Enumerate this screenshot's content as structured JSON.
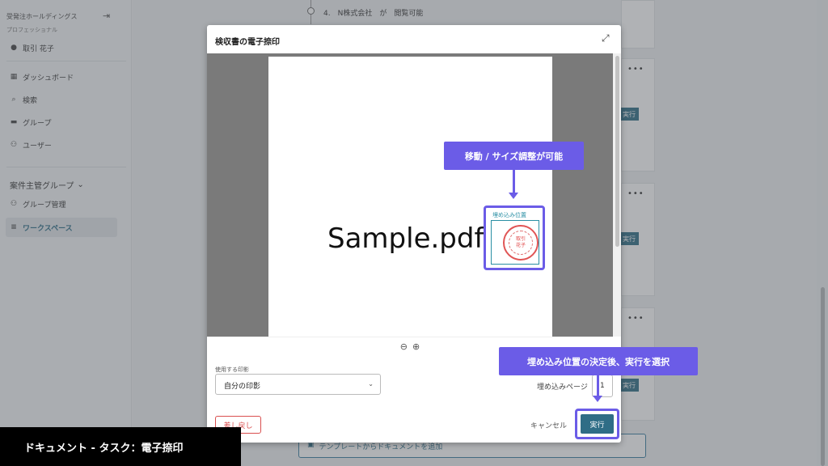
{
  "sidebar": {
    "company": "受発注ホールディングス",
    "plan": "プロフェッショナル",
    "user": "取引 花子",
    "nav": [
      "ダッシュボード",
      "検索",
      "グループ",
      "ユーザー"
    ],
    "group_header": "案件主管グループ",
    "group_items": [
      "グループ管理",
      "ワークスペース"
    ]
  },
  "background": {
    "timeline_item": "4.　N株式会社　が　閲覧可能",
    "run_short": "実行",
    "template_button": "テンプレートからドキュメントを追加"
  },
  "modal": {
    "title": "検収書の電子捺印",
    "document_text": "Sample.pdf",
    "stamp_label": "埋め込み位置",
    "seal_name_top": "取引",
    "seal_name_bottom": "花子",
    "seal_label": "使用する印影",
    "seal_value": "自分の印影",
    "embed_page_label": "埋め込みページ",
    "embed_page_value": "1",
    "back_button": "差し戻し",
    "cancel_button": "キャンセル",
    "run_button": "実行"
  },
  "callouts": {
    "move": "移動 / サイズ調整が可能",
    "run": "埋め込み位置の決定後、実行を選択"
  },
  "caption": "ドキュメント - タスク：電子捺印",
  "colors": {
    "accent": "#6b5ce7",
    "primary": "#2f6d86",
    "danger": "#d94f4f"
  }
}
